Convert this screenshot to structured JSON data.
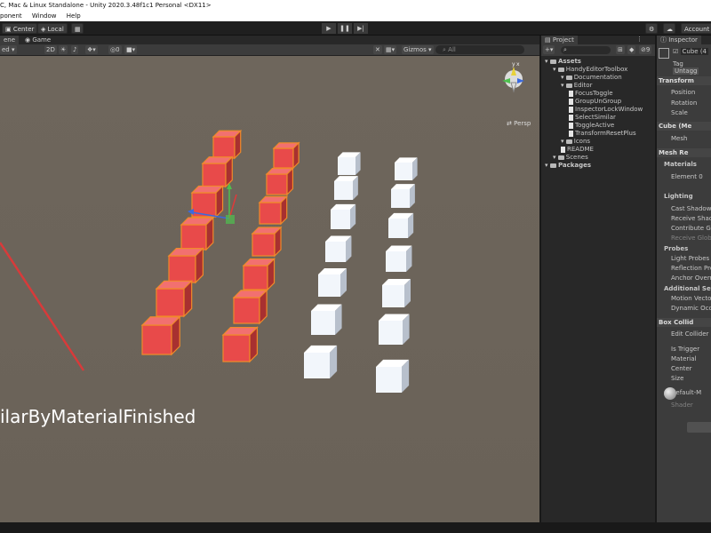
{
  "window": {
    "title": "C, Mac & Linux Standalone - Unity 2020.3.48f1c1 Personal <DX11>"
  },
  "menu": {
    "items": [
      "ponent",
      "Window",
      "Help"
    ]
  },
  "toolbar": {
    "center": "Center",
    "local": "Local",
    "account": "Account"
  },
  "scene": {
    "tabs": [
      "ene",
      "Game"
    ],
    "shading": "ed",
    "mode_2d": "2D",
    "fx_count": "0",
    "gizmos": "Gizmos",
    "search_placeholder": "All",
    "persp_label": "Persp",
    "overlay_text": "ilarByMaterialFinished",
    "colors": {
      "red_cube": "#e84a4a",
      "white_cube": "#e8eef6",
      "selection": "#f08a2a"
    }
  },
  "project": {
    "tab": "Project",
    "badge": "9",
    "tree": [
      {
        "label": "Assets",
        "level": 0,
        "kind": "folder",
        "bold": true
      },
      {
        "label": "HandyEditorToolbox",
        "level": 1,
        "kind": "folder"
      },
      {
        "label": "Documentation",
        "level": 2,
        "kind": "folder"
      },
      {
        "label": "Editor",
        "level": 2,
        "kind": "folder"
      },
      {
        "label": "FocusToggle",
        "level": 3,
        "kind": "file"
      },
      {
        "label": "GroupUnGroup",
        "level": 3,
        "kind": "file"
      },
      {
        "label": "InspectorLockWindow",
        "level": 3,
        "kind": "file"
      },
      {
        "label": "SelectSimilar",
        "level": 3,
        "kind": "file"
      },
      {
        "label": "ToggleActive",
        "level": 3,
        "kind": "file"
      },
      {
        "label": "TransformResetPlus",
        "level": 3,
        "kind": "file"
      },
      {
        "label": "Icons",
        "level": 2,
        "kind": "folder"
      },
      {
        "label": "README",
        "level": 2,
        "kind": "file"
      },
      {
        "label": "Scenes",
        "level": 1,
        "kind": "folder"
      },
      {
        "label": "Packages",
        "level": 0,
        "kind": "folder",
        "bold": true
      }
    ]
  },
  "inspector": {
    "tab": "Inspector",
    "object_name": "Cube (4",
    "tag_label": "Tag",
    "tag_value": "Untagg",
    "rows": [
      {
        "label": "Transform",
        "header": true
      },
      {
        "label": "Position"
      },
      {
        "label": "Rotation"
      },
      {
        "label": "Scale"
      },
      {
        "label": "Cube (Me",
        "header": true
      },
      {
        "label": "Mesh"
      },
      {
        "label": "Mesh Re",
        "header": true
      },
      {
        "label": "Materials",
        "bold": true
      },
      {
        "label": "Element 0"
      },
      {
        "label": "Lighting",
        "bold": true
      },
      {
        "label": "Cast Shadows"
      },
      {
        "label": "Receive Shad"
      },
      {
        "label": "Contribute Glo"
      },
      {
        "label": "Receive Glob",
        "muted": true
      },
      {
        "label": "Probes",
        "bold": true
      },
      {
        "label": "Light Probes"
      },
      {
        "label": "Reflection Pro"
      },
      {
        "label": "Anchor Overri"
      },
      {
        "label": "Additional Setti",
        "bold": true
      },
      {
        "label": "Motion Vector"
      },
      {
        "label": "Dynamic Occl"
      },
      {
        "label": "Box Collid",
        "header": true
      },
      {
        "label": "Edit Collider"
      },
      {
        "label": "Is Trigger"
      },
      {
        "label": "Material"
      },
      {
        "label": "Center"
      },
      {
        "label": "Size"
      },
      {
        "label": "Default-M"
      },
      {
        "label": "Shader",
        "muted": true
      }
    ]
  }
}
